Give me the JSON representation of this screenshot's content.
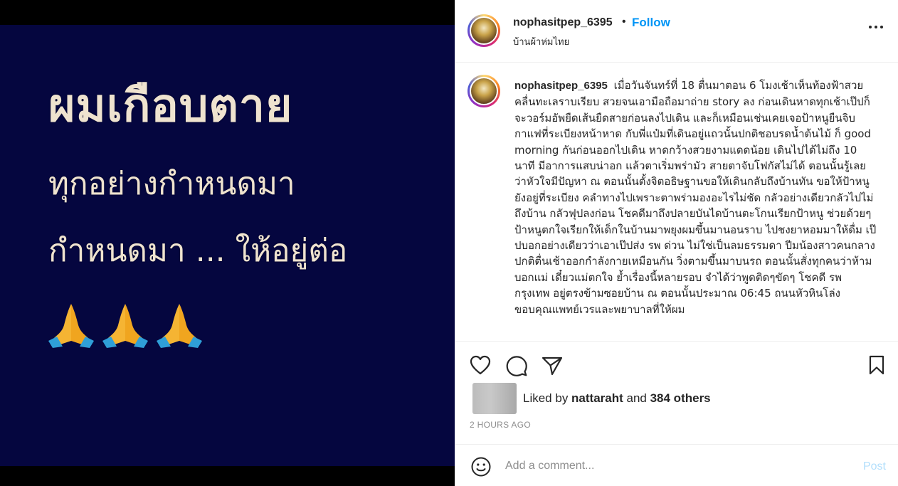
{
  "media": {
    "line1": "ผมเกือบตาย",
    "line2": "ทุกอย่างกำหนดมา",
    "line3": "กำหนดมา ... ให้อยู่ต่อ",
    "emoji_count": 3
  },
  "header": {
    "username": "nophasitpep_6395",
    "separator": "•",
    "follow_label": "Follow",
    "location": "บ้านผ้าห่มไทย"
  },
  "caption": {
    "username": "nophasitpep_6395",
    "text": "เมื่อวันจันทร์ที่ 18 ตื่นมาตอน 6 โมงเช้าเห็นท้องฟ้าสวยคลื่นทะเลราบเรียบ สวยจนเอามือถือมาถ่าย story ลง ก่อนเดินหาดทุกเช้าเป๊ปก็จะวอร์มอัพยืดเส้นยืดสายก่อนลงไปเดิน และก็เหมือนเช่นเคยเจอป้าหนูยืนจิบกาแฟที่ระเบียงหน้าหาด กับพี่แป๋มที่เดินอยู่แถวนั้นปกติชอบรดน้ำต้นไม้ ก็ good morning กันก่อนออกไปเดิน หาดกว้างสวยงามแดดน้อย เดินไปได้ไม่ถึง 10 นาที มีอาการแสบน่าอก แล้วตาเริ่มพร่ามัว สายตาจับโฟกัสไม่ได้ ตอนนั้นรู้เลยว่าหัวใจมีปัญหา ณ ตอนนั้นตั้งจิตอธิษฐานขอให้เดินกลับถึงบ้านทัน ขอให้ป้าหนูยังอยู่ที่ระเบียง คลำทางไปเพราะตาพร่ามองอะไรไม่ชัด กลัวอย่างเดียวกลัวไปไม่ถึงบ้าน กลัวฟุปลงก่อน โชคดีมาถึงปลายบันไดบ้านตะโกนเรียกป้าหนู ช่วยด้วยๆ ป้าหนูตกใจเรียกให้เด็กในบ้านมาพยุงผมขึ้นมานอนราบ ไปชงยาหอมมาให้ดื่ม เป๊ปบอกอย่างเดียวว่าเอาเป๊ปส่ง รพ ด่วน ไม่ใช่เป็นลมธรรมดา ปีมน้องสาวคนกลางปกติตื่นเช้าออกกำลังกายเหมือนกัน วิ่งตามขึ้นมาบนรถ ตอนนั้นสั่งทุกคนว่าห้ามบอกแม่ เดี๋ยวแม่ตกใจ ย้ำเรื่องนี้หลายรอบ จำได้ว่าพูดติดๆขัดๆ โชคดี รพ กรุงเทพ อยู่ตรงข้ามซอยบ้าน ณ ตอนนั้นประมาณ 06:45 ถนนหัวหินโล่ง ขอบคุณแพทย์เวรและพยาบาลที่ให้ผม"
  },
  "likes": {
    "prefix": "Liked by ",
    "user": "nattaraht",
    "middle": " and ",
    "others": "384 others"
  },
  "timestamp": "2 HOURS AGO",
  "comment": {
    "placeholder": "Add a comment...",
    "post_label": "Post"
  },
  "colors": {
    "accent": "#0095f6",
    "post_disabled": "#b2dffc",
    "media_bg": "#05063f",
    "media_text": "#efe3cf"
  },
  "icons": [
    "heart-icon",
    "comment-icon",
    "share-icon",
    "bookmark-icon",
    "more-icon",
    "emoji-icon",
    "prayer-hands-icon"
  ]
}
